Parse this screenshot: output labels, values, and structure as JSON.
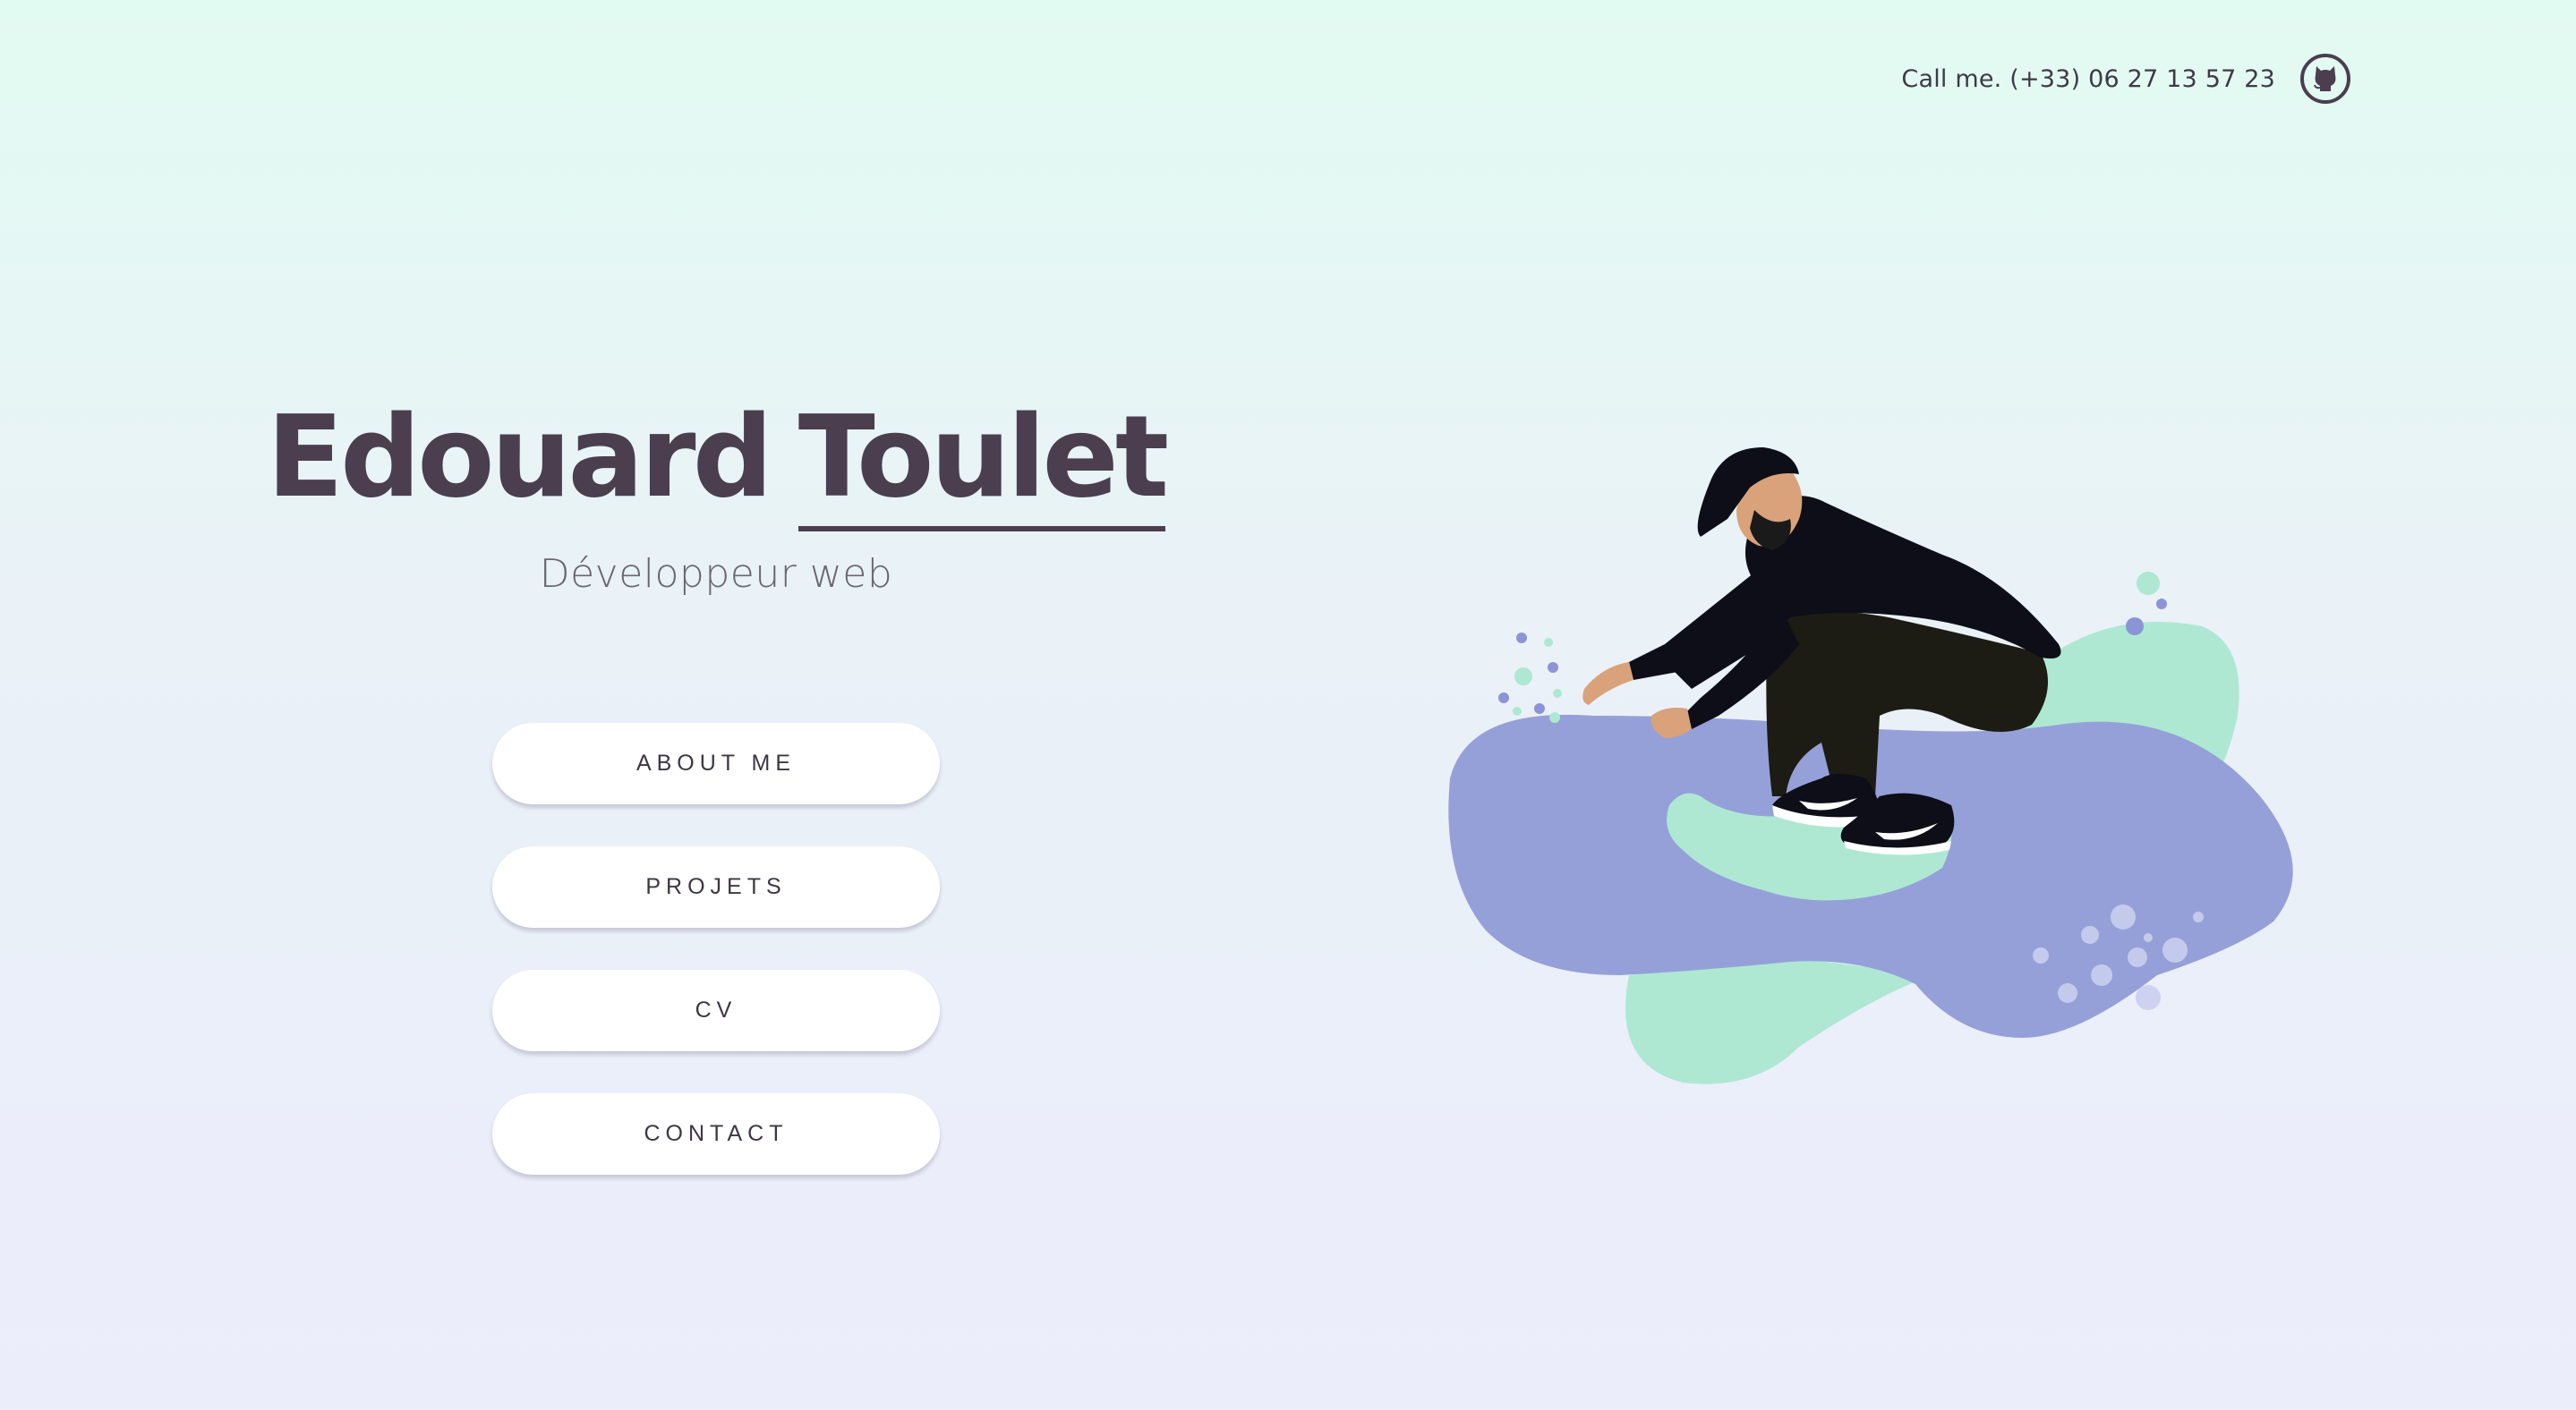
{
  "header": {
    "phone_text": "Call me. (+33) 06 27 13 57 23",
    "github_icon": "github-icon"
  },
  "hero": {
    "first_name": "Edouard",
    "last_name": "Toulet",
    "subtitle": "Développeur web"
  },
  "menu": {
    "items": [
      {
        "label": "ABOUT ME"
      },
      {
        "label": "PROJETS"
      },
      {
        "label": "CV"
      },
      {
        "label": "CONTACT"
      }
    ]
  },
  "illustration": {
    "icon": "crouching-person-illustration",
    "colors": {
      "blob_purple": "#96a0d8",
      "blob_mint": "#aee8d3",
      "clothing": "#0d0e17",
      "skin": "#d9a27a"
    }
  },
  "colors": {
    "primary_text": "#4a3e4f",
    "button_bg": "#ffffff"
  }
}
